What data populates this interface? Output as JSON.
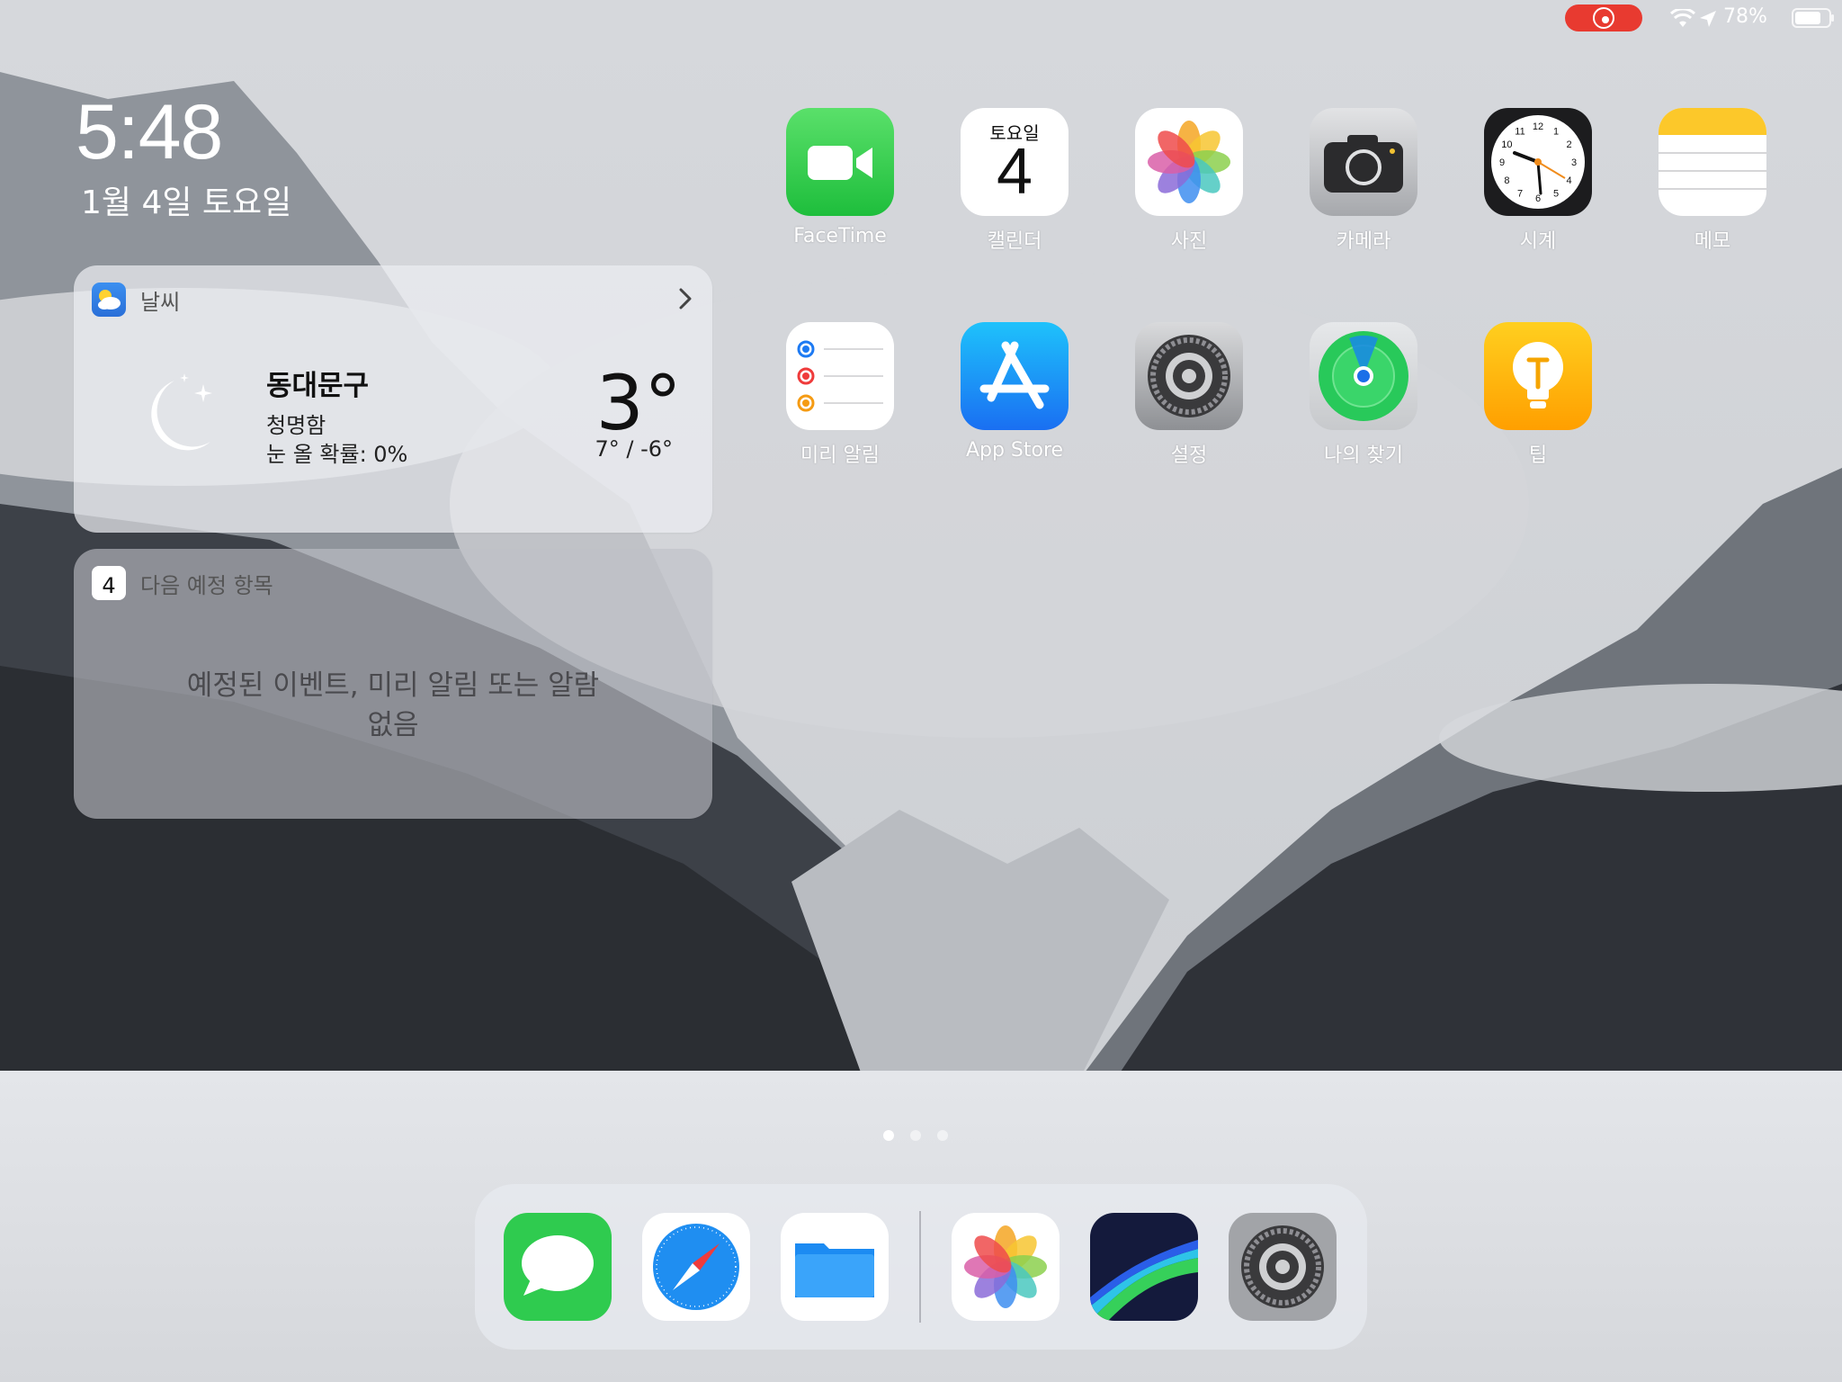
{
  "status_bar": {
    "battery_percent": "78%",
    "battery_level": 0.78,
    "recording": true
  },
  "lock_clock": {
    "time": "5:48",
    "date": "1월 4일 토요일"
  },
  "weather_widget": {
    "title": "날씨",
    "location": "동대문구",
    "condition": "청명함",
    "precipitation": "눈 올 확률: 0%",
    "temperature": "3°",
    "range": "7° / -6°"
  },
  "upnext_widget": {
    "title": "다음 예정 항목",
    "calendar_day": "4",
    "empty_message": "예정된 이벤트, 미리 알림 또는 알람 없음"
  },
  "apps": [
    {
      "label": "FaceTime"
    },
    {
      "label": "캘린더",
      "weekday": "토요일",
      "day": "4"
    },
    {
      "label": "사진"
    },
    {
      "label": "카메라"
    },
    {
      "label": "시계"
    },
    {
      "label": "메모"
    },
    {
      "label": "미리 알림"
    },
    {
      "label": "App Store"
    },
    {
      "label": "설정"
    },
    {
      "label": "나의 찾기"
    },
    {
      "label": "팁"
    }
  ],
  "clock_face": {
    "numbers": [
      "12",
      "1",
      "2",
      "3",
      "4",
      "5",
      "6",
      "7",
      "8",
      "9",
      "10",
      "11"
    ]
  },
  "page_indicator": {
    "count": 3,
    "active": 0
  },
  "colors": {
    "facetime": "#2fc948",
    "appstore": "#1d8cf8",
    "tips": "#ffb300",
    "record": "#e83a30"
  },
  "dock": {
    "apps": [
      "messages-icon",
      "safari-icon",
      "files-icon",
      "photos-icon",
      "luma-fusion-icon",
      "settings-icon"
    ]
  }
}
